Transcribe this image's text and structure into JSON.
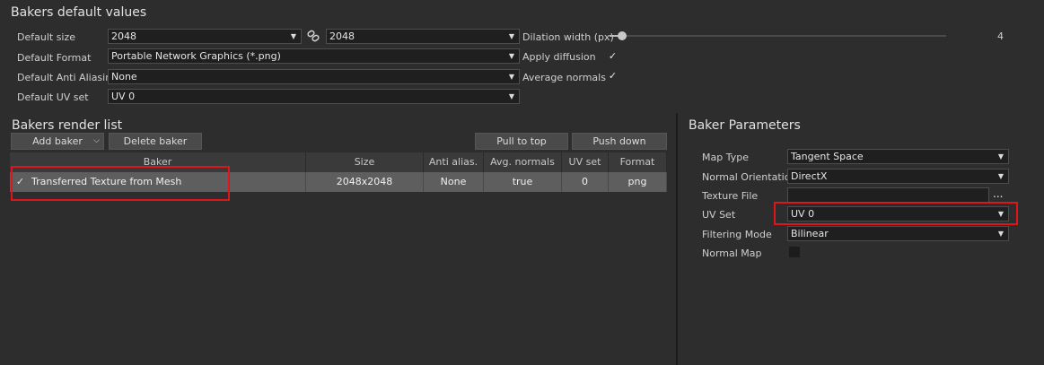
{
  "defaults": {
    "title": "Bakers default values",
    "size_label": "Default size",
    "size_w": "2048",
    "size_h": "2048",
    "link_icon": "link-icon",
    "format_label": "Default Format",
    "format_value": "Portable Network Graphics (*.png)",
    "aa_label": "Default Anti Aliasing",
    "aa_value": "None",
    "uv_label": "Default UV set",
    "uv_value": "UV 0",
    "dilation_label": "Dilation width (px)",
    "dilation_value": "4",
    "dilation_fraction": 0.03,
    "diffusion_label": "Apply diffusion",
    "diffusion_checked": true,
    "avgnormals_label": "Average normals",
    "avgnormals_checked": true
  },
  "renderlist": {
    "title": "Bakers render list",
    "add_label": "Add baker",
    "delete_label": "Delete baker",
    "pull_label": "Pull to top",
    "push_label": "Push down",
    "columns": [
      "Baker",
      "Size",
      "Anti alias.",
      "Avg. normals",
      "UV set",
      "Format"
    ],
    "rows": [
      {
        "checked": true,
        "name": "Transferred Texture from Mesh",
        "size": "2048x2048",
        "aa": "None",
        "avg": "true",
        "uv": "0",
        "format": "png"
      }
    ]
  },
  "params": {
    "title": "Baker Parameters",
    "maptype_label": "Map Type",
    "maptype_value": "Tangent Space",
    "orientation_label": "Normal Orientation",
    "orientation_value": "DirectX",
    "texture_label": "Texture File",
    "texture_value": "",
    "browse_label": "...",
    "uvset_label": "UV Set",
    "uvset_value": "UV 0",
    "filtering_label": "Filtering Mode",
    "filtering_value": "Bilinear",
    "normalmap_label": "Normal Map",
    "normalmap_checked": false
  },
  "colors": {
    "highlight": "#e0141b",
    "background": "#2d2d2d",
    "selected_row": "#5e5e5e"
  }
}
